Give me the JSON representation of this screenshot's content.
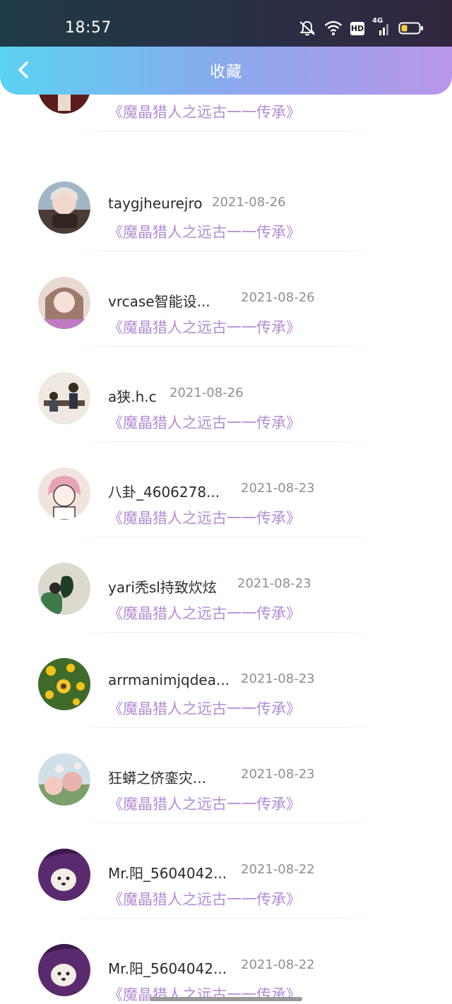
{
  "status_bar": {
    "time": "18:57",
    "hd": "HD",
    "network": "4G",
    "icons": [
      "mute-bell-icon",
      "wifi-icon",
      "hd-icon",
      "signal-icon",
      "battery-icon"
    ]
  },
  "header": {
    "title": "收藏",
    "back_icon": "chevron-left-icon"
  },
  "colors": {
    "header_start": "#5ad2f2",
    "header_end": "#b996ea",
    "work_title": "#b28cd6",
    "date": "#8f8f8f"
  },
  "favorites": [
    {
      "name": "",
      "date": "",
      "work": "《魔晶猎人之远古一一传承》"
    },
    {
      "name": "taygjheurejro",
      "date": "2021-08-26",
      "work": "《魔晶猎人之远古一一传承》"
    },
    {
      "name": "vrcase智能设...",
      "date": "2021-08-26",
      "work": "《魔晶猎人之远古一一传承》"
    },
    {
      "name": "a狭.h.c",
      "date": "2021-08-26",
      "work": "《魔晶猎人之远古一一传承》"
    },
    {
      "name": "八卦_4606278...",
      "date": "2021-08-23",
      "work": "《魔晶猎人之远古一一传承》"
    },
    {
      "name": "yari秃sl持致炊炫",
      "date": "2021-08-23",
      "work": "《魔晶猎人之远古一一传承》"
    },
    {
      "name": "arrmanimjqdea...",
      "date": "2021-08-23",
      "work": "《魔晶猎人之远古一一传承》"
    },
    {
      "name": "狂蟒之侪銮灾...",
      "date": "2021-08-23",
      "work": "《魔晶猎人之远古一一传承》"
    },
    {
      "name": "Mr.阳_5604042...",
      "date": "2021-08-22",
      "work": "《魔晶猎人之远古一一传承》"
    },
    {
      "name": "Mr.阳_5604042...",
      "date": "2021-08-22",
      "work": "《魔晶猎人之远古一一传承》"
    }
  ]
}
